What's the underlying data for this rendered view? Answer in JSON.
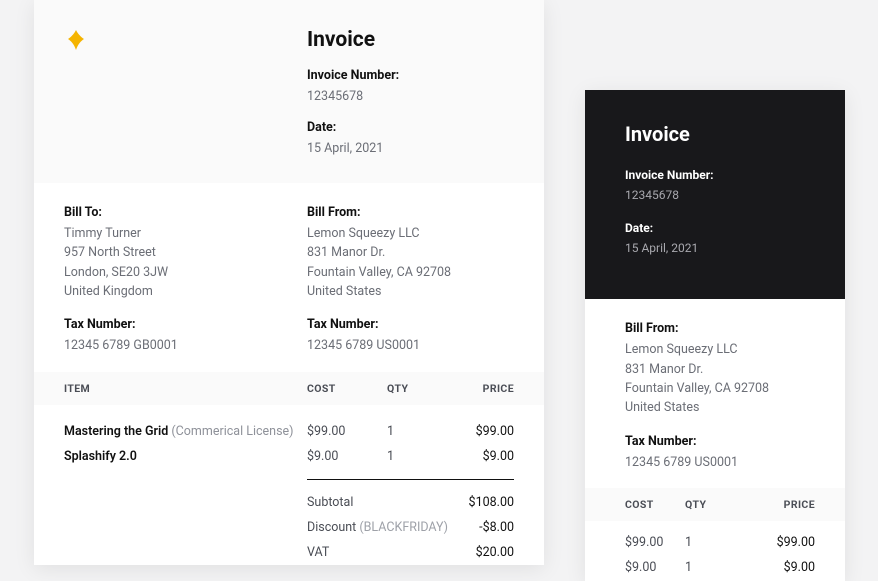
{
  "invoice1": {
    "title": "Invoice",
    "number_label": "Invoice Number:",
    "number": "12345678",
    "date_label": "Date:",
    "date": "15 April, 2021",
    "bill_to": {
      "label": "Bill To:",
      "name": "Timmy Turner",
      "line1": "957 North Street",
      "line2": "London, SE20 3JW",
      "country": "United Kingdom",
      "tax_label": "Tax Number:",
      "tax": "12345 6789 GB0001"
    },
    "bill_from": {
      "label": "Bill From:",
      "name": "Lemon Squeezy LLC",
      "line1": "831 Manor Dr.",
      "line2": "Fountain Valley, CA 92708",
      "country": "United States",
      "tax_label": "Tax Number:",
      "tax": "12345 6789 US0001"
    },
    "headers": {
      "item": "ITEM",
      "cost": "COST",
      "qty": "QTY",
      "price": "PRICE"
    },
    "items": [
      {
        "name": "Mastering the Grid",
        "note": "(Commerical License)",
        "cost": "$99.00",
        "qty": "1",
        "price": "$99.00"
      },
      {
        "name": "Splashify 2.0",
        "note": "",
        "cost": "$9.00",
        "qty": "1",
        "price": "$9.00"
      }
    ],
    "totals": {
      "subtotal_label": "Subtotal",
      "subtotal": "$108.00",
      "discount_label": "Discount",
      "discount_note": "(BLACKFRIDAY)",
      "discount": "-$8.00",
      "vat_label": "VAT",
      "vat": "$20.00"
    }
  },
  "invoice2": {
    "title": "Invoice",
    "number_label": "Invoice Number:",
    "number": "12345678",
    "date_label": "Date:",
    "date": "15 April, 2021",
    "bill_from": {
      "label": "Bill From:",
      "name": "Lemon Squeezy LLC",
      "line1": "831 Manor Dr.",
      "line2": "Fountain Valley, CA 92708",
      "country": "United States",
      "tax_label": "Tax Number:",
      "tax": "12345 6789 US0001"
    },
    "headers": {
      "cost": "COST",
      "qty": "QTY",
      "price": "PRICE"
    },
    "items": [
      {
        "cost": "$99.00",
        "qty": "1",
        "price": "$99.00"
      },
      {
        "cost": "$9.00",
        "qty": "1",
        "price": "$9.00"
      }
    ]
  }
}
